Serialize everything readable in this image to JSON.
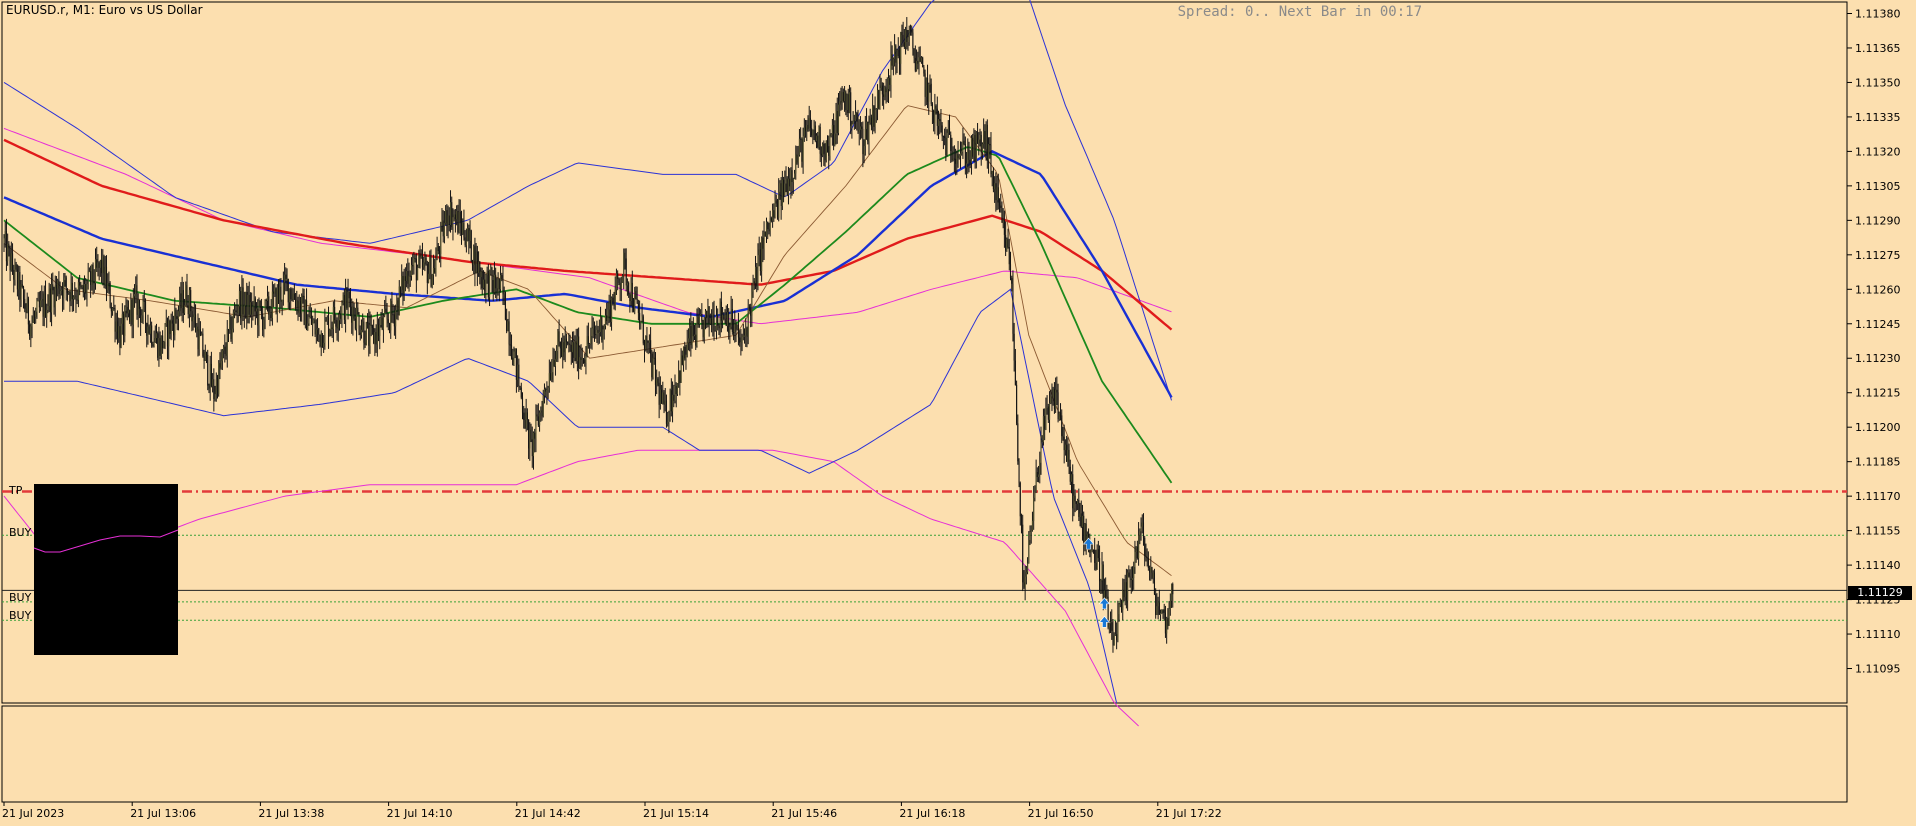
{
  "header": {
    "title": "EURUSD.r, M1:  Euro vs US Dollar",
    "spread_text": "Spread: 0.. Next Bar in 00:17"
  },
  "levels": {
    "tp_label": "TP",
    "buy_labels": [
      "BUY",
      "BUY",
      "BUY"
    ],
    "current_price_label": "1.11129"
  },
  "colors": {
    "background": "#fcdfaf",
    "candle": "#141414",
    "bb_inner": "#2b32d6",
    "bb_outer": "#e62fd6",
    "ma_slow": "#e01b1b",
    "ma_mid": "#1930d4",
    "ma_fast": "#1d8a1d",
    "ma_thin": "#8b5a33",
    "tp_line": "#e23a3a",
    "buy_line": "#3aa13a",
    "signal_arrow": "#1878d6"
  },
  "chart_data": {
    "type": "candlestick",
    "symbol": "EURUSD.r",
    "timeframe": "M1",
    "y_range": [
      1.1108,
      1.11385
    ],
    "y_ticks": [
      1.11095,
      1.1111,
      1.11125,
      1.1114,
      1.11155,
      1.1117,
      1.11185,
      1.112,
      1.11215,
      1.1123,
      1.11245,
      1.1126,
      1.11275,
      1.1129,
      1.11305,
      1.1132,
      1.11335,
      1.1135,
      1.11365,
      1.1138
    ],
    "x_labels": [
      "21 Jul 2023",
      "21 Jul 13:06",
      "21 Jul 13:38",
      "21 Jul 14:10",
      "21 Jul 14:42",
      "21 Jul 15:14",
      "21 Jul 15:46",
      "21 Jul 16:18",
      "21 Jul 16:50",
      "21 Jul 17:22"
    ],
    "current_price": 1.11129,
    "tp_level": 1.11172,
    "buy_levels": [
      1.11153,
      1.11124,
      1.11116
    ],
    "close_path": [
      [
        0,
        1.1128
      ],
      [
        22,
        1.11245
      ],
      [
        45,
        1.11262
      ],
      [
        64,
        1.11258
      ],
      [
        80,
        1.1127
      ],
      [
        95,
        1.1124
      ],
      [
        108,
        1.11255
      ],
      [
        128,
        1.11235
      ],
      [
        150,
        1.11258
      ],
      [
        172,
        1.11215
      ],
      [
        192,
        1.11255
      ],
      [
        212,
        1.11248
      ],
      [
        232,
        1.11262
      ],
      [
        258,
        1.1124
      ],
      [
        282,
        1.11255
      ],
      [
        300,
        1.11238
      ],
      [
        320,
        1.1125
      ],
      [
        332,
        1.1127
      ],
      [
        352,
        1.11268
      ],
      [
        364,
        1.11295
      ],
      [
        378,
        1.11285
      ],
      [
        392,
        1.11265
      ],
      [
        408,
        1.1126
      ],
      [
        432,
        1.1119
      ],
      [
        452,
        1.11235
      ],
      [
        474,
        1.11232
      ],
      [
        494,
        1.11248
      ],
      [
        508,
        1.1127
      ],
      [
        522,
        1.11245
      ],
      [
        542,
        1.11205
      ],
      [
        562,
        1.11238
      ],
      [
        580,
        1.11248
      ],
      [
        592,
        1.1125
      ],
      [
        605,
        1.11235
      ],
      [
        622,
        1.1128
      ],
      [
        640,
        1.11305
      ],
      [
        660,
        1.1133
      ],
      [
        676,
        1.1132
      ],
      [
        688,
        1.11345
      ],
      [
        704,
        1.11325
      ],
      [
        722,
        1.1135
      ],
      [
        740,
        1.11372
      ],
      [
        756,
        1.11348
      ],
      [
        770,
        1.11325
      ],
      [
        790,
        1.11318
      ],
      [
        805,
        1.11325
      ],
      [
        815,
        1.11295
      ],
      [
        825,
        1.1127
      ],
      [
        836,
        1.11125
      ],
      [
        850,
        1.11195
      ],
      [
        862,
        1.11215
      ],
      [
        878,
        1.11165
      ],
      [
        890,
        1.1115
      ],
      [
        900,
        1.11135
      ],
      [
        908,
        1.11105
      ],
      [
        920,
        1.11128
      ],
      [
        932,
        1.11155
      ],
      [
        944,
        1.11125
      ],
      [
        952,
        1.11115
      ],
      [
        958,
        1.11129
      ]
    ],
    "bollinger_inner": {
      "upper": [
        [
          0,
          1.1135
        ],
        [
          60,
          1.1133
        ],
        [
          140,
          1.113
        ],
        [
          220,
          1.11285
        ],
        [
          300,
          1.1128
        ],
        [
          380,
          1.1129
        ],
        [
          430,
          1.11305
        ],
        [
          470,
          1.11315
        ],
        [
          540,
          1.1131
        ],
        [
          600,
          1.1131
        ],
        [
          640,
          1.113
        ],
        [
          680,
          1.11315
        ],
        [
          720,
          1.11355
        ],
        [
          760,
          1.11385
        ],
        [
          800,
          1.114
        ],
        [
          835,
          1.11395
        ],
        [
          870,
          1.1134
        ],
        [
          910,
          1.1129
        ],
        [
          958,
          1.1121
        ]
      ],
      "lower": [
        [
          0,
          1.1122
        ],
        [
          60,
          1.1122
        ],
        [
          140,
          1.1121
        ],
        [
          180,
          1.11205
        ],
        [
          260,
          1.1121
        ],
        [
          320,
          1.11215
        ],
        [
          380,
          1.1123
        ],
        [
          430,
          1.1122
        ],
        [
          470,
          1.112
        ],
        [
          540,
          1.112
        ],
        [
          570,
          1.1119
        ],
        [
          620,
          1.1119
        ],
        [
          660,
          1.1118
        ],
        [
          700,
          1.1119
        ],
        [
          760,
          1.1121
        ],
        [
          800,
          1.1125
        ],
        [
          825,
          1.1126
        ],
        [
          860,
          1.1117
        ],
        [
          890,
          1.1113
        ],
        [
          912,
          1.1108
        ]
      ]
    },
    "bollinger_outer": {
      "upper": [
        [
          0,
          1.1133
        ],
        [
          100,
          1.1131
        ],
        [
          180,
          1.1129
        ],
        [
          260,
          1.1128
        ],
        [
          340,
          1.11275
        ],
        [
          410,
          1.1127
        ],
        [
          480,
          1.11265
        ],
        [
          560,
          1.1125
        ],
        [
          620,
          1.11245
        ],
        [
          700,
          1.1125
        ],
        [
          760,
          1.1126
        ],
        [
          820,
          1.11268
        ],
        [
          880,
          1.11265
        ],
        [
          958,
          1.1125
        ]
      ],
      "lower": [
        [
          0,
          1.1117
        ],
        [
          30,
          1.1115
        ],
        [
          60,
          1.11148
        ],
        [
          110,
          1.1115
        ],
        [
          160,
          1.1116
        ],
        [
          230,
          1.1117
        ],
        [
          300,
          1.11175
        ],
        [
          370,
          1.11175
        ],
        [
          420,
          1.11175
        ],
        [
          470,
          1.11185
        ],
        [
          520,
          1.1119
        ],
        [
          580,
          1.1119
        ],
        [
          630,
          1.1119
        ],
        [
          680,
          1.11185
        ],
        [
          720,
          1.1117
        ],
        [
          760,
          1.1116
        ],
        [
          820,
          1.1115
        ],
        [
          870,
          1.1112
        ],
        [
          910,
          1.1108
        ],
        [
          930,
          1.1107
        ]
      ]
    },
    "moving_averages": [
      {
        "role": "slow",
        "points": [
          [
            0,
            1.11325
          ],
          [
            80,
            1.11305
          ],
          [
            180,
            1.1129
          ],
          [
            280,
            1.1128
          ],
          [
            380,
            1.11272
          ],
          [
            460,
            1.11268
          ],
          [
            540,
            1.11265
          ],
          [
            620,
            1.11262
          ],
          [
            680,
            1.11268
          ],
          [
            740,
            1.11282
          ],
          [
            810,
            1.11292
          ],
          [
            850,
            1.11285
          ],
          [
            900,
            1.11268
          ],
          [
            958,
            1.11242
          ]
        ]
      },
      {
        "role": "mid",
        "points": [
          [
            0,
            1.113
          ],
          [
            80,
            1.11282
          ],
          [
            160,
            1.11272
          ],
          [
            240,
            1.11262
          ],
          [
            320,
            1.11258
          ],
          [
            400,
            1.11255
          ],
          [
            460,
            1.11258
          ],
          [
            520,
            1.11252
          ],
          [
            580,
            1.11248
          ],
          [
            640,
            1.11255
          ],
          [
            700,
            1.11275
          ],
          [
            760,
            1.11305
          ],
          [
            810,
            1.1132
          ],
          [
            850,
            1.1131
          ],
          [
            900,
            1.11268
          ],
          [
            958,
            1.11212
          ]
        ]
      },
      {
        "role": "fast",
        "points": [
          [
            0,
            1.1129
          ],
          [
            60,
            1.11265
          ],
          [
            140,
            1.11255
          ],
          [
            220,
            1.11252
          ],
          [
            300,
            1.11248
          ],
          [
            360,
            1.11255
          ],
          [
            420,
            1.1126
          ],
          [
            470,
            1.1125
          ],
          [
            530,
            1.11245
          ],
          [
            600,
            1.11245
          ],
          [
            640,
            1.11262
          ],
          [
            690,
            1.11285
          ],
          [
            740,
            1.1131
          ],
          [
            790,
            1.11322
          ],
          [
            815,
            1.11318
          ],
          [
            850,
            1.1128
          ],
          [
            900,
            1.1122
          ],
          [
            958,
            1.11175
          ]
        ]
      },
      {
        "role": "thin",
        "points": [
          [
            0,
            1.1128
          ],
          [
            50,
            1.1126
          ],
          [
            120,
            1.11255
          ],
          [
            200,
            1.11248
          ],
          [
            270,
            1.11255
          ],
          [
            330,
            1.11252
          ],
          [
            390,
            1.11268
          ],
          [
            430,
            1.1126
          ],
          [
            480,
            1.1123
          ],
          [
            540,
            1.11235
          ],
          [
            600,
            1.1124
          ],
          [
            640,
            1.11275
          ],
          [
            690,
            1.11305
          ],
          [
            740,
            1.1134
          ],
          [
            780,
            1.11335
          ],
          [
            815,
            1.1131
          ],
          [
            840,
            1.1124
          ],
          [
            880,
            1.11185
          ],
          [
            920,
            1.1115
          ],
          [
            958,
            1.11135
          ]
        ]
      }
    ],
    "signals": [
      {
        "type": "buy",
        "x": 889,
        "price": 1.1115
      },
      {
        "type": "buy",
        "x": 902,
        "price": 1.11124
      },
      {
        "type": "buy",
        "x": 902,
        "price": 1.11116
      }
    ]
  }
}
